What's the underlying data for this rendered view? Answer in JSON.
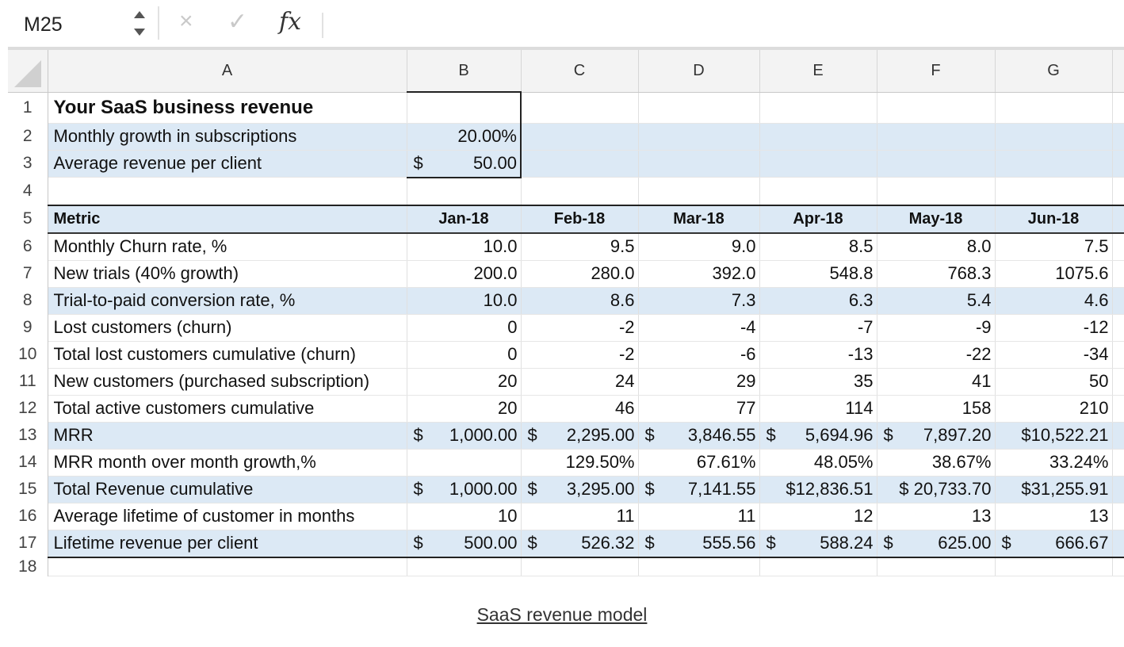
{
  "formula_bar": {
    "cell_ref": "M25",
    "cancel_icon": "×",
    "enter_icon": "✓",
    "fx_label": "fx"
  },
  "columns": [
    "A",
    "B",
    "C",
    "D",
    "E",
    "F",
    "G"
  ],
  "rows": [
    {
      "num": "1",
      "a": "Your SaaS business revenue",
      "vals": [
        "",
        "",
        "",
        "",
        "",
        ""
      ]
    },
    {
      "num": "2",
      "a": "Monthly growth in subscriptions",
      "vals": [
        "20.00%",
        "",
        "",
        "",
        "",
        ""
      ]
    },
    {
      "num": "3",
      "a": "Average revenue per client",
      "vals": [
        "$|50.00",
        "",
        "",
        "",
        "",
        ""
      ]
    },
    {
      "num": "4",
      "a": "",
      "vals": [
        "",
        "",
        "",
        "",
        "",
        ""
      ]
    },
    {
      "num": "5",
      "a": "Metric",
      "vals": [
        "Jan-18",
        "Feb-18",
        "Mar-18",
        "Apr-18",
        "May-18",
        "Jun-18"
      ]
    },
    {
      "num": "6",
      "a": "Monthly Churn rate, %",
      "vals": [
        "10.0",
        "9.5",
        "9.0",
        "8.5",
        "8.0",
        "7.5"
      ]
    },
    {
      "num": "7",
      "a": "New trials (40% growth)",
      "vals": [
        "200.0",
        "280.0",
        "392.0",
        "548.8",
        "768.3",
        "1075.6"
      ]
    },
    {
      "num": "8",
      "a": "Trial-to-paid conversion rate, %",
      "vals": [
        "10.0",
        "8.6",
        "7.3",
        "6.3",
        "5.4",
        "4.6"
      ]
    },
    {
      "num": "9",
      "a": "Lost customers (churn)",
      "vals": [
        "0",
        "-2",
        "-4",
        "-7",
        "-9",
        "-12"
      ]
    },
    {
      "num": "10",
      "a": "Total lost customers cumulative (churn)",
      "vals": [
        "0",
        "-2",
        "-6",
        "-13",
        "-22",
        "-34"
      ]
    },
    {
      "num": "11",
      "a": "New customers (purchased subscription)",
      "vals": [
        "20",
        "24",
        "29",
        "35",
        "41",
        "50"
      ]
    },
    {
      "num": "12",
      "a": "Total active customers cumulative",
      "vals": [
        "20",
        "46",
        "77",
        "114",
        "158",
        "210"
      ]
    },
    {
      "num": "13",
      "a": "MRR",
      "vals": [
        "$|1,000.00",
        "$|2,295.00",
        "$|3,846.55",
        "$|5,694.96",
        "$|7,897.20",
        "$10,522.21"
      ]
    },
    {
      "num": "14",
      "a": "MRR month over month growth,%",
      "vals": [
        "",
        "129.50%",
        "67.61%",
        "48.05%",
        "38.67%",
        "33.24%"
      ]
    },
    {
      "num": "15",
      "a": "Total Revenue cumulative",
      "vals": [
        "$|1,000.00",
        "$|3,295.00",
        "$|7,141.55",
        "$12,836.51",
        "$ 20,733.70",
        "$31,255.91"
      ]
    },
    {
      "num": "16",
      "a": "Average lifetime of customer in months",
      "vals": [
        "10",
        "11",
        "11",
        "12",
        "13",
        "13"
      ]
    },
    {
      "num": "17",
      "a": "Lifetime revenue per client",
      "vals": [
        "$|500.00",
        "$|526.32",
        "$|555.56",
        "$|588.24",
        "$|625.00",
        "$|666.67"
      ]
    },
    {
      "num": "18",
      "a": "",
      "vals": [
        "",
        "",
        "",
        "",
        "",
        ""
      ]
    }
  ],
  "caption": "SaaS revenue model"
}
